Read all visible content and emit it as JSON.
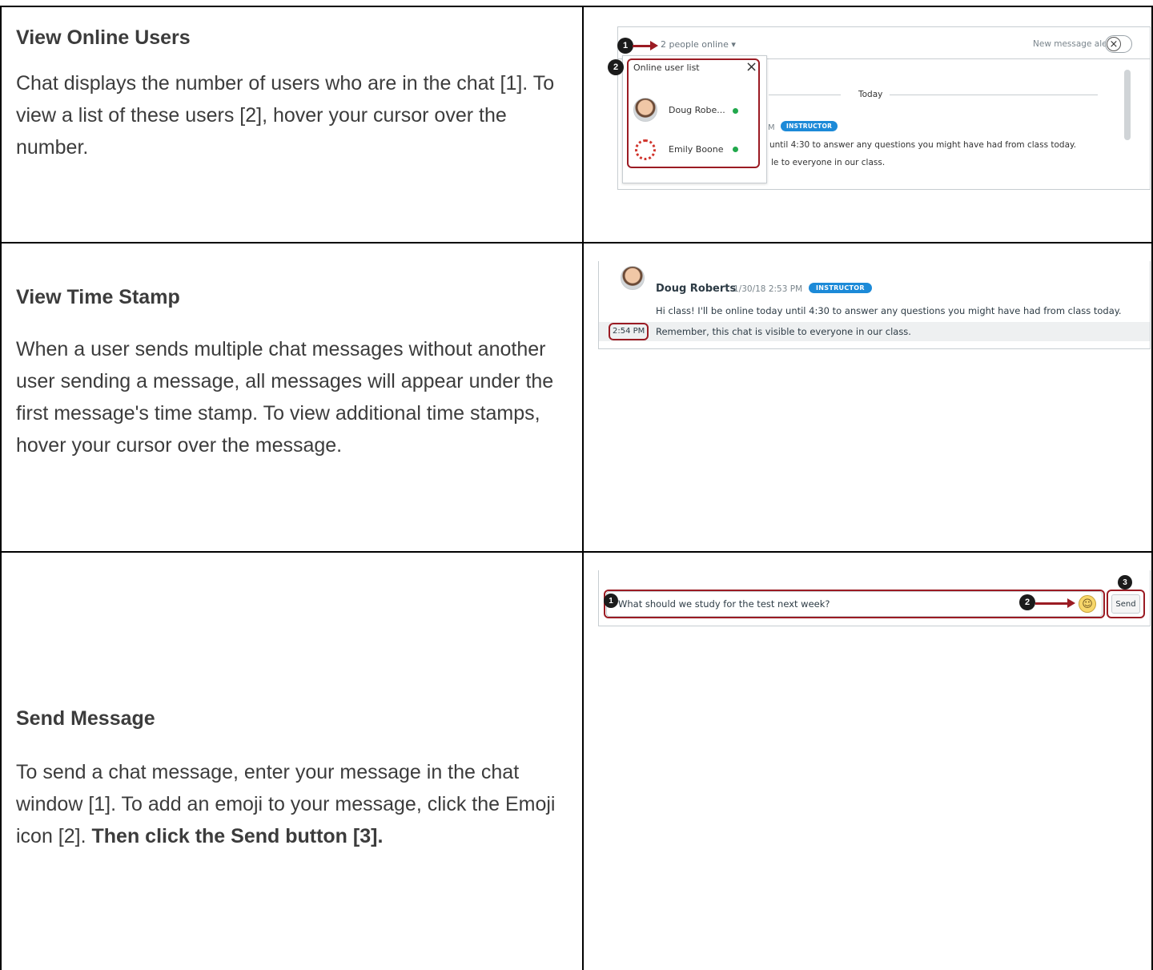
{
  "rows": [
    {
      "title": "View Online Users",
      "body": "Chat displays the number of users who are in the chat [1]. To view a list of these users [2], hover your cursor over the number."
    },
    {
      "title": "View Time Stamp",
      "body": "When a user sends multiple chat messages without another user sending a message, all messages will appear under the first message's time stamp. To view additional time stamps, hover your cursor over the message."
    },
    {
      "title": "Send Message",
      "body_plain": "To send a chat message, enter your message in the chat window [1]. To add an emoji to your message, click the Emoji icon [2]. ",
      "body_bold": "Then click the Send button [3]."
    }
  ],
  "shot1": {
    "online_count": "2 people online ▾",
    "alerts_label": "New message alerts",
    "popup_title": "Online user list",
    "users": [
      "Doug Robe...",
      "Emily Boone"
    ],
    "date_divider": "Today",
    "time_fragment": "M",
    "badge": "INSTRUCTOR",
    "msg1_fragment": "until 4:30 to answer any questions you might have had from class today.",
    "msg2_fragment": "le to everyone in our class.",
    "callouts": [
      "1",
      "2"
    ]
  },
  "shot2": {
    "author": "Doug Roberts",
    "timestamp": "1/30/18 2:53 PM",
    "badge": "INSTRUCTOR",
    "message1": "Hi class! I'll be online today until 4:30 to answer any questions you might have had from class today.",
    "hover_time": "2:54 PM",
    "message2": "Remember, this chat is visible to everyone in our class."
  },
  "shot3": {
    "input_value": "What should we study for the test next week?",
    "send_label": "Send",
    "callouts": [
      "1",
      "2",
      "3"
    ]
  },
  "colors": {
    "callout_red": "#9b1b23",
    "badge_blue": "#1c8ad8",
    "online_green": "#21a84c"
  }
}
